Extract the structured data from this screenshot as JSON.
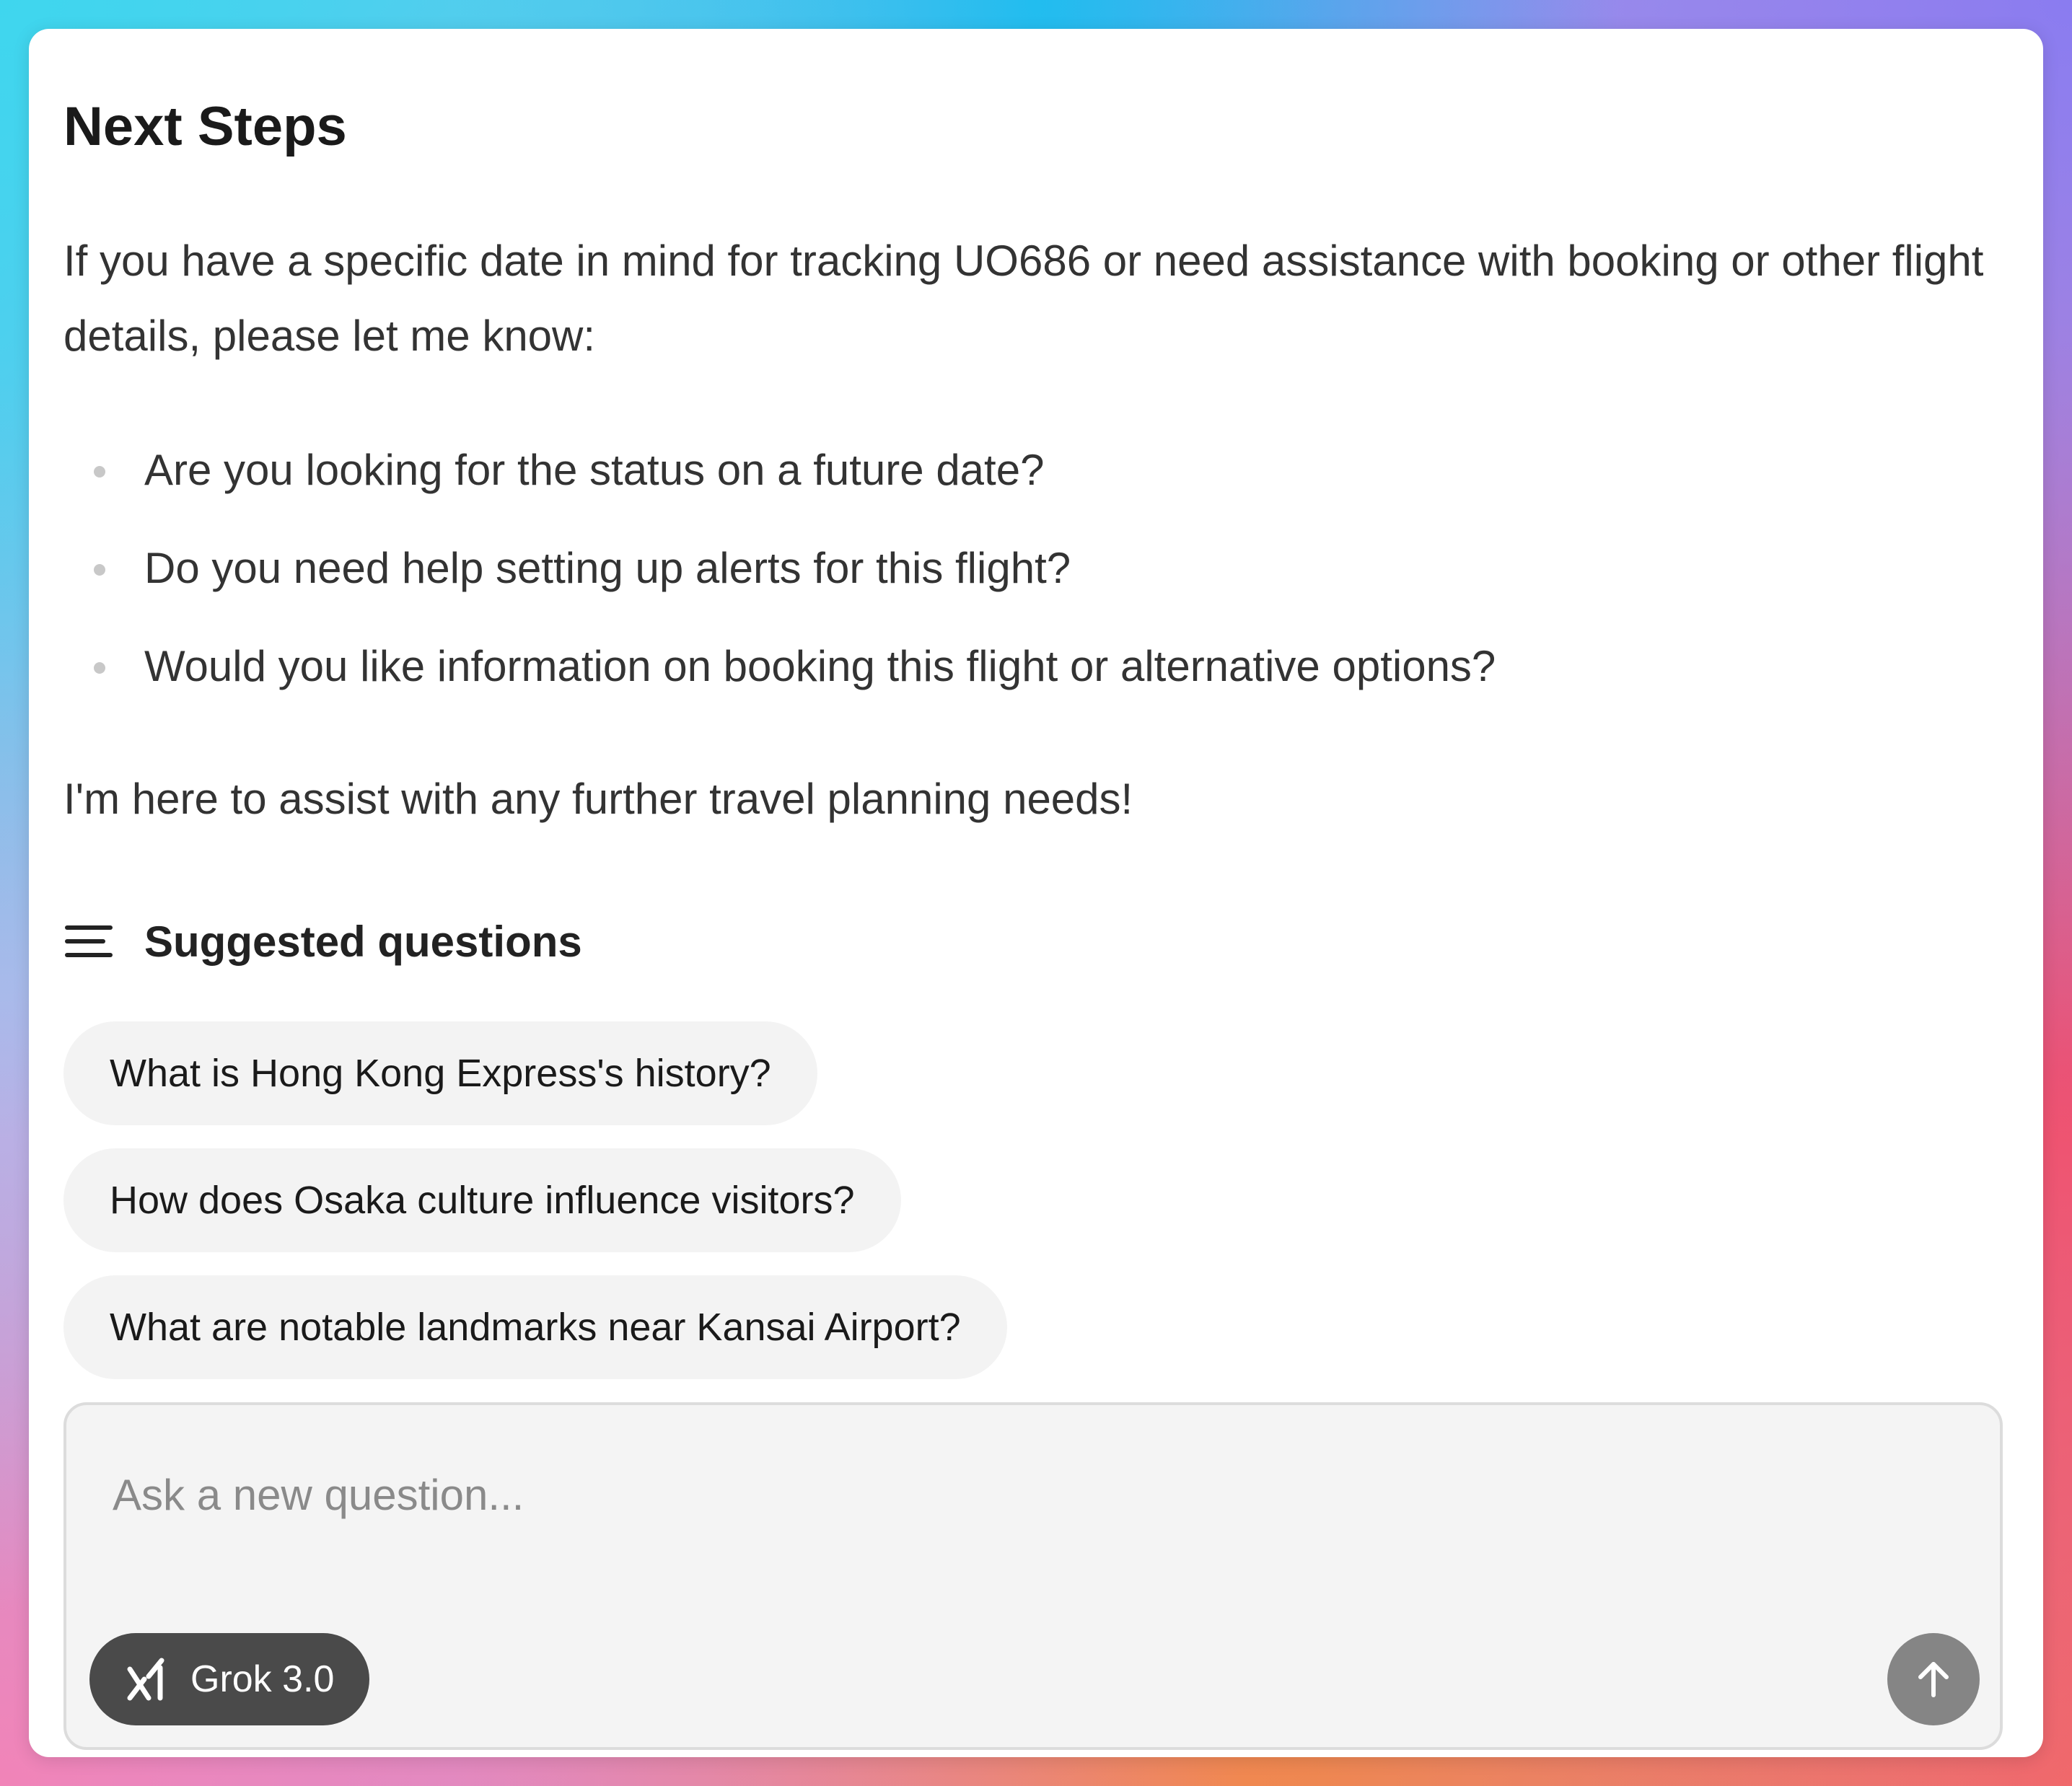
{
  "response": {
    "heading": "Next Steps",
    "paragraph": "If you have a specific date in mind for tracking UO686 or need assistance with booking or other flight details, please let me know:",
    "bullets": [
      "Are you looking for the status on a future date?",
      "Do you need help setting up alerts for this flight?",
      "Would you like information on booking this flight or alternative options?"
    ],
    "closing": "I'm here to assist with any further travel planning needs!"
  },
  "suggested": {
    "icon": "menu-lines-icon",
    "title": "Suggested questions",
    "questions": [
      "What is Hong Kong Express's history?",
      "How does Osaka culture influence visitors?",
      "What are notable landmarks near Kansai Airport?"
    ]
  },
  "composer": {
    "value": "",
    "placeholder": "Ask a new question...",
    "model_label": "Grok 3.0",
    "model_icon": "grok-logo-icon",
    "send_icon": "arrow-up-icon"
  },
  "colors": {
    "card_background": "#ffffff",
    "chip_background": "#f3f3f3",
    "composer_background": "#f4f4f4",
    "model_button": "#4a4a4a",
    "send_button": "#858585"
  }
}
